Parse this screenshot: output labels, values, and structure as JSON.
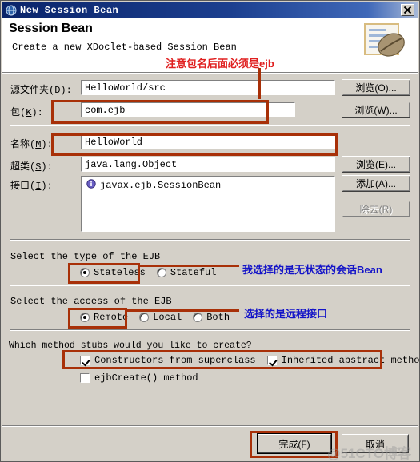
{
  "window": {
    "title": "New Session Bean",
    "icon": "eclipse-globe-icon",
    "close_label": "×"
  },
  "header": {
    "title": "Session Bean",
    "subtitle": "Create a new XDoclet-based Session Bean",
    "image": "session-bean-wizard-icon"
  },
  "form": {
    "source_folder": {
      "label_prefix": "源文件夹(",
      "mnemonic": "D",
      "label_suffix": "):",
      "value": "HelloWorld/src",
      "button": "浏览(O)..."
    },
    "package": {
      "label_prefix": "包(",
      "mnemonic": "K",
      "label_suffix": "):",
      "value": "com.ejb",
      "button": "浏览(W)..."
    },
    "name": {
      "label_prefix": "名称(",
      "mnemonic": "M",
      "label_suffix": "):",
      "value": "HelloWorld"
    },
    "superclass": {
      "label_prefix": "超类(",
      "mnemonic": "S",
      "label_suffix": "):",
      "value": "java.lang.Object",
      "button": "浏览(E)..."
    },
    "interfaces": {
      "label_prefix": "接口(",
      "mnemonic": "I",
      "label_suffix": "):",
      "items": [
        "javax.ejb.SessionBean"
      ],
      "add_button": "添加(A)...",
      "remove_button": "除去(R)"
    }
  },
  "ejb_type": {
    "prompt": "Select the type of the EJB",
    "options": [
      {
        "label": "Stateless",
        "selected": true
      },
      {
        "label": "Stateful",
        "selected": false
      }
    ]
  },
  "ejb_access": {
    "prompt": "Select the access of the EJB",
    "options": [
      {
        "label": "Remote",
        "selected": true
      },
      {
        "label": "Local",
        "selected": false
      },
      {
        "label": "Both",
        "selected": false
      }
    ]
  },
  "method_stubs": {
    "prompt": "Which method stubs would you like to create?",
    "options": [
      {
        "label_a": "C",
        "label_b": "onstructors from superclass",
        "checked": true
      },
      {
        "label_a": "In",
        "label_b": "h",
        "label_c": "erited abstract methods",
        "checked": true
      },
      {
        "label_a": "ejbCreate() method",
        "checked": false
      }
    ]
  },
  "footer": {
    "finish_button": "完成(F)",
    "cancel_button": "取消"
  },
  "annotations": {
    "package_note": "注意包名后面必须是ejb",
    "type_note": "我选择的是无状态的会话Bean",
    "access_note": "选择的是远程接口",
    "box_color": "#a83008",
    "red_text_color": "#e02020",
    "blue_text_color": "#1414c8"
  },
  "watermark": {
    "text": "@51CTO博客"
  }
}
